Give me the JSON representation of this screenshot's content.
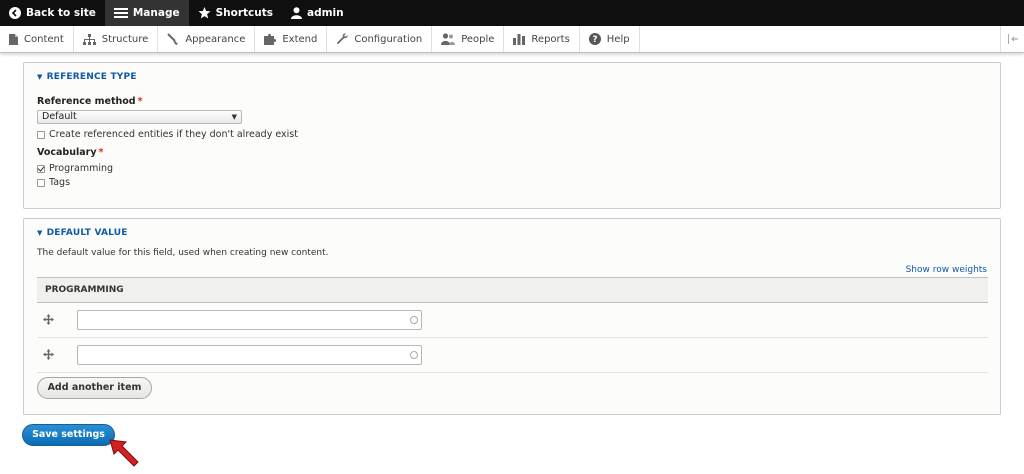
{
  "toolbar": {
    "back_label": "Back to site",
    "manage_label": "Manage",
    "shortcuts_label": "Shortcuts",
    "user_label": "admin"
  },
  "tray": {
    "content": "Content",
    "structure": "Structure",
    "appearance": "Appearance",
    "extend": "Extend",
    "configuration": "Configuration",
    "people": "People",
    "reports": "Reports",
    "help": "Help"
  },
  "reference_type": {
    "legend": "REFERENCE TYPE",
    "method_label": "Reference method",
    "method_value": "Default",
    "auto_create_label": "Create referenced entities if they don't already exist",
    "auto_create_checked": false,
    "vocabulary_label": "Vocabulary",
    "vocabularies": [
      {
        "label": "Programming",
        "checked": true
      },
      {
        "label": "Tags",
        "checked": false
      }
    ]
  },
  "default_value": {
    "legend": "DEFAULT VALUE",
    "description": "The default value for this field, used when creating new content.",
    "row_weights_link": "Show row weights",
    "table_header": "PROGRAMMING",
    "rows": [
      {
        "value": ""
      },
      {
        "value": ""
      }
    ],
    "add_button": "Add another item"
  },
  "actions": {
    "save_button": "Save settings"
  },
  "colors": {
    "toolbar_bg": "#0f0f0f",
    "link_blue": "#0e5aa6",
    "primary_button": "#0a6cb4",
    "required_star": "#e32700",
    "pointer_arrow": "#d42020"
  },
  "icons": {
    "back": "circle-arrow-left-icon",
    "manage": "hamburger-icon",
    "shortcuts": "star-icon",
    "user": "person-icon",
    "content": "document-icon",
    "structure": "sitemap-icon",
    "appearance": "paintbrush-icon",
    "extend": "puzzle-icon",
    "configuration": "wrench-icon",
    "people": "people-icon",
    "reports": "bar-chart-icon",
    "help": "question-circle-icon",
    "drag": "drag-handle-icon",
    "annotation": "red-arrow-pointer-icon"
  }
}
